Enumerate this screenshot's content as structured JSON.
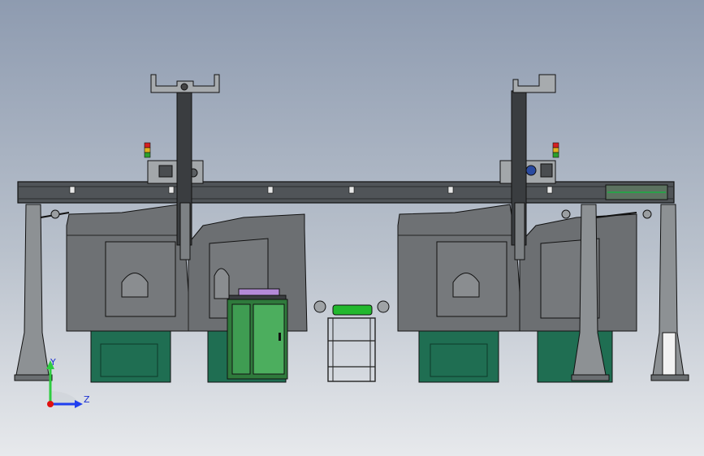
{
  "triad": {
    "y_label": "Y",
    "z_label": "Z",
    "y_color": "#2ecc40",
    "z_color": "#1f3ff0",
    "x_color": "#e01010"
  },
  "colors": {
    "background_top": "#8e9bb0",
    "background_bottom": "#e7e9ec",
    "gantry_beam": "#505458",
    "machine_housing": "#6e7174",
    "machine_base": "#1f6e52",
    "loading_station": "#3f9c52",
    "conveyor_roller": "#22b82e",
    "stack_light": [
      "#d62020",
      "#e0b020",
      "#2ca02c"
    ]
  }
}
